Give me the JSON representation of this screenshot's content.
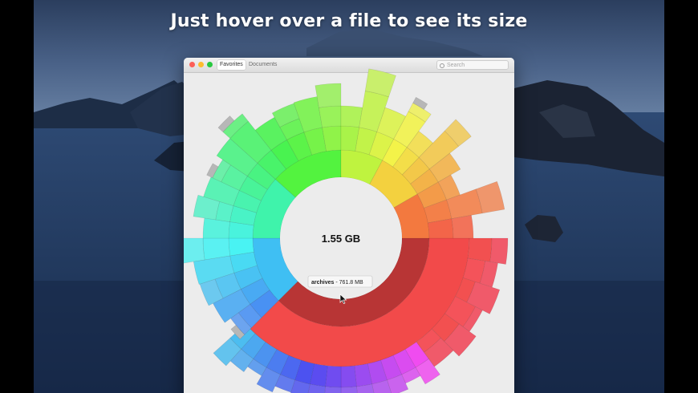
{
  "headline": "Just hover over a file to see its size",
  "window": {
    "tabs": [
      {
        "label": "Favorites",
        "active": true
      },
      {
        "label": "Documents",
        "active": false
      }
    ],
    "search_placeholder": "Search"
  },
  "sunburst": {
    "total": "1.55 GB",
    "tooltip_name": "archives",
    "tooltip_separator": " - ",
    "tooltip_size": "761.8 MB",
    "hovered_segment": "archives"
  },
  "colors": {
    "traffic_close": "#fc5f57",
    "traffic_minimize": "#fdbc2e",
    "traffic_zoom": "#28c840",
    "hover_highlight": "#b83535"
  },
  "icons": [
    "search-icon",
    "cursor-icon"
  ]
}
